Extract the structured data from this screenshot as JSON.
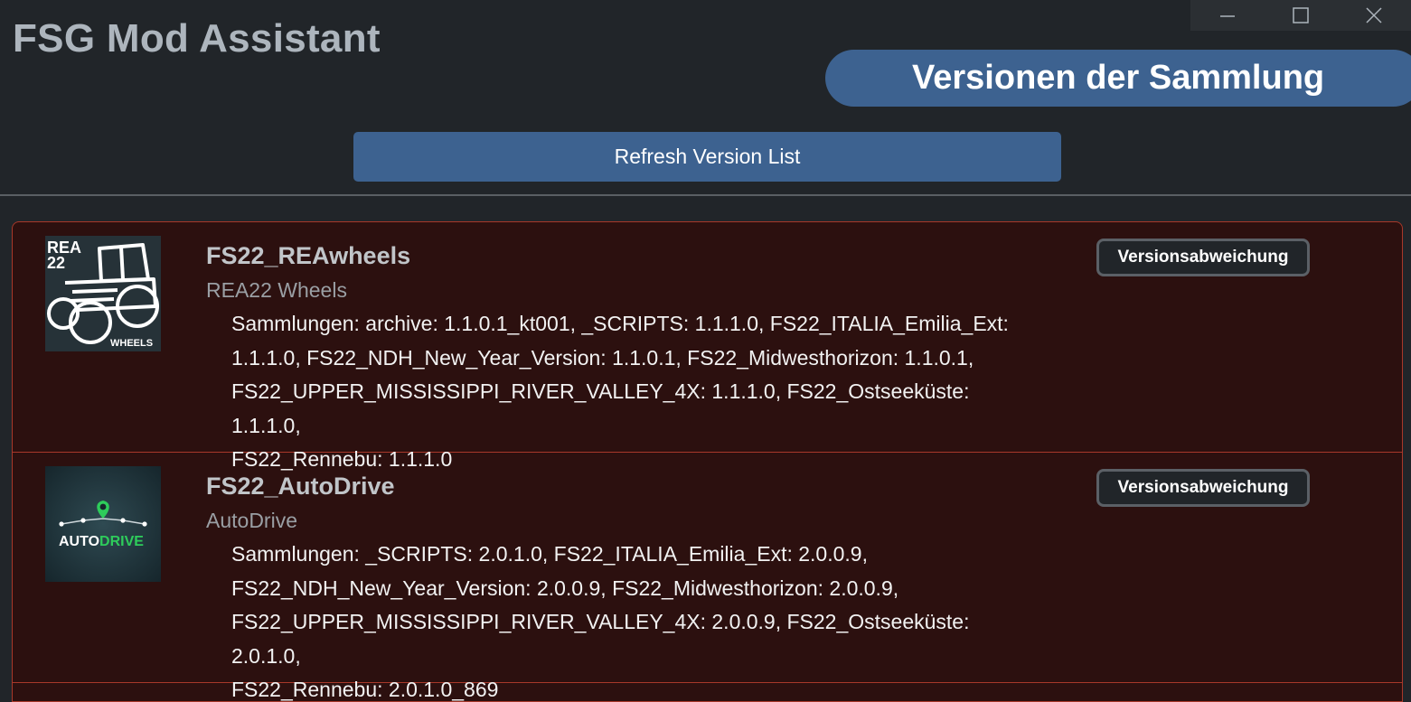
{
  "app": {
    "title": "FSG Mod Assistant"
  },
  "window_controls": {
    "minimize_icon": "minimize-icon",
    "maximize_icon": "maximize-icon",
    "close_icon": "close-icon"
  },
  "header": {
    "section_title": "Versionen der Sammlung",
    "refresh_label": "Refresh Version List"
  },
  "colors": {
    "accent": "#3d6290",
    "mismatch_border": "#a8382a",
    "mismatch_background": "#2c100f"
  },
  "mods": [
    {
      "name": "FS22_REAwheels",
      "title": "REA22 Wheels",
      "badge": "Versionsabweichung",
      "icon": {
        "name": "rea22-wheels-icon",
        "text_top": "REA",
        "text_num": "22",
        "text_bottom": "WHEELS"
      },
      "collections_lines": [
        "Sammlungen: archive: 1.1.0.1_kt001, _SCRIPTS: 1.1.1.0, FS22_ITALIA_Emilia_Ext:",
        "1.1.1.0, FS22_NDH_New_Year_Version: 1.1.0.1, FS22_Midwesthorizon: 1.1.0.1,",
        "FS22_UPPER_MISSISSIPPI_RIVER_VALLEY_4X: 1.1.1.0, FS22_Ostseeküste: 1.1.1.0,",
        "FS22_Rennebu: 1.1.1.0"
      ]
    },
    {
      "name": "FS22_AutoDrive",
      "title": "AutoDrive",
      "badge": "Versionsabweichung",
      "icon": {
        "name": "autodrive-icon",
        "text_a": "AUTO",
        "text_b": "DRIVE"
      },
      "collections_lines": [
        "Sammlungen: _SCRIPTS: 2.0.1.0, FS22_ITALIA_Emilia_Ext: 2.0.0.9,",
        "FS22_NDH_New_Year_Version: 2.0.0.9, FS22_Midwesthorizon: 2.0.0.9,",
        "FS22_UPPER_MISSISSIPPI_RIVER_VALLEY_4X: 2.0.0.9, FS22_Ostseeküste: 2.0.1.0,",
        "FS22_Rennebu: 2.0.1.0_869"
      ]
    }
  ]
}
